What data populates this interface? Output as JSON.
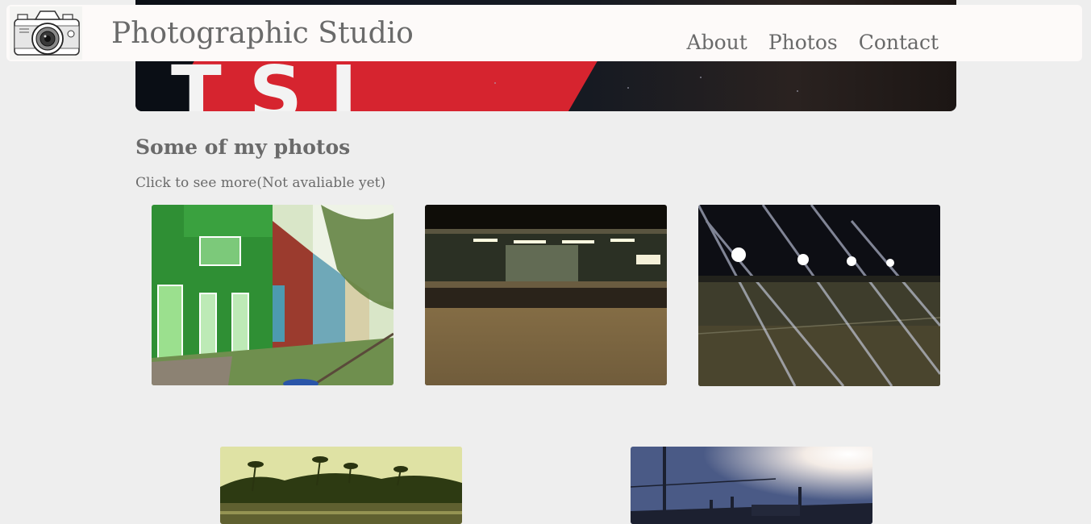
{
  "header": {
    "site_title": "Photographic Studio",
    "logo_icon": "camera-logo-icon",
    "nav": [
      {
        "label": "About"
      },
      {
        "label": "Photos"
      },
      {
        "label": "Contact"
      }
    ]
  },
  "hero": {
    "banner_text": "TSI"
  },
  "main": {
    "title": "Some of my photos",
    "subtitle": "Click to see more(Not avaliable yet)"
  },
  "photos": [
    {
      "name": "photo-green-houses"
    },
    {
      "name": "photo-train-station"
    },
    {
      "name": "photo-field-lights"
    },
    {
      "name": "photo-lake-palms"
    },
    {
      "name": "photo-sunset-rail"
    }
  ],
  "colors": {
    "background": "#eeeeee",
    "header_bg": "#fdfaf9",
    "text": "#6a6a6a",
    "banner_red": "#d6242f"
  }
}
